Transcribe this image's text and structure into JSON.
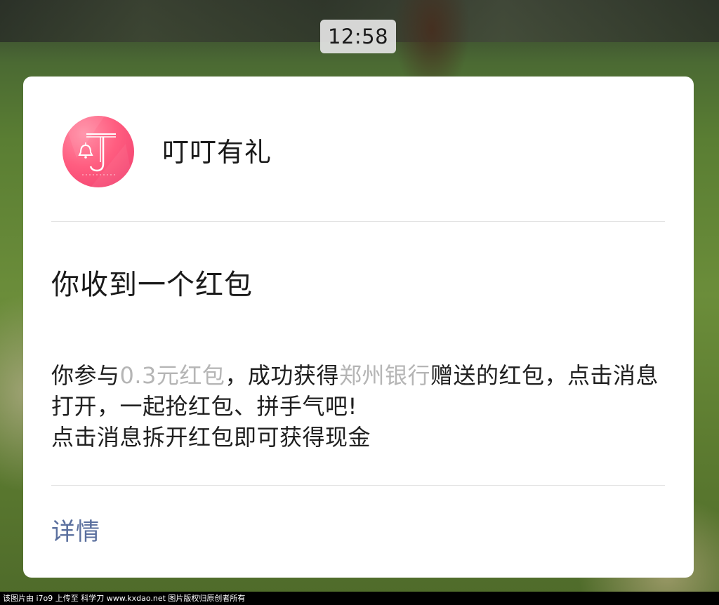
{
  "status": {
    "time": "12:58"
  },
  "notification": {
    "app_icon": "bell-j-logo-icon",
    "app_name": "叮叮有礼",
    "title": "你收到一个红包",
    "body": {
      "seg1": "你参与",
      "amount": "0.3元红包",
      "seg2": "，成功获得",
      "bank": "郑州银行",
      "seg3": "赠送的红包，点击消息打开，一起抢红包、拼手气吧!",
      "line3": "点击消息拆开红包即可获得现金"
    },
    "details_label": "详情"
  },
  "watermark": {
    "text": "该图片由 i7o9 上传至 科学刀 www.kxdao.net 图片版权归原创者所有"
  },
  "colors": {
    "avatar": "#ff5d80",
    "muted_text": "#b5b5b5",
    "link": "#5a6f9e"
  }
}
